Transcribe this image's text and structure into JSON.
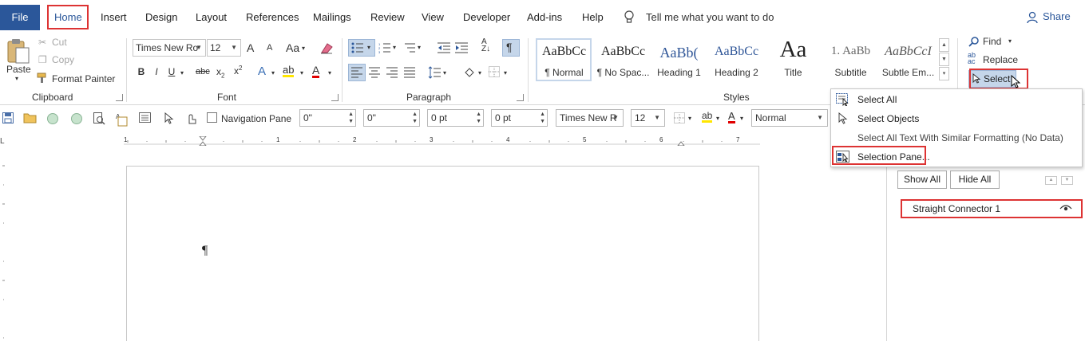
{
  "tabs": {
    "file": "File",
    "home": "Home",
    "insert": "Insert",
    "design": "Design",
    "layout": "Layout",
    "references": "References",
    "mailings": "Mailings",
    "review": "Review",
    "view": "View",
    "developer": "Developer",
    "addins": "Add-ins",
    "help": "Help",
    "tell_me": "Tell me what you want to do",
    "share": "Share"
  },
  "clipboard": {
    "paste": "Paste",
    "cut": "Cut",
    "copy": "Copy",
    "format_painter": "Format Painter",
    "group_label": "Clipboard"
  },
  "font": {
    "font_name": "Times New Ro",
    "font_size": "12",
    "grow": "A",
    "shrink": "A",
    "change_case": "Aa",
    "bold": "B",
    "italic": "I",
    "underline": "U",
    "strikethrough": "abc",
    "subscript": "x",
    "superscript": "x",
    "group_label": "Font"
  },
  "paragraph": {
    "group_label": "Paragraph",
    "show_marks": "¶"
  },
  "styles": {
    "group_label": "Styles",
    "items": [
      {
        "sample": "AaBbCc",
        "name": "¶ Normal"
      },
      {
        "sample": "AaBbCc",
        "name": "¶ No Spac..."
      },
      {
        "sample": "AaBb(",
        "name": "Heading 1"
      },
      {
        "sample": "AaBbCc",
        "name": "Heading 2"
      },
      {
        "sample": "Aa",
        "name": "Title"
      },
      {
        "sample": "1.  AaBb",
        "name": "Subtitle"
      },
      {
        "sample": "AaBbCcI",
        "name": "Subtle Em..."
      }
    ]
  },
  "editing": {
    "find": "Find",
    "replace": "Replace",
    "select": "Select"
  },
  "select_menu": {
    "select_all": "Select All",
    "select_objects": "Select Objects",
    "select_similar": "Select All Text With Similar Formatting (No Data)",
    "selection_pane": "Selection Pane..."
  },
  "quick_access": {
    "nav_pane": "Navigation Pane",
    "indent_left": "0\"",
    "indent_right": "0\"",
    "space_before": "0 pt",
    "space_after": "0 pt",
    "font_name": "Times New R",
    "font_size": "12",
    "style": "Normal"
  },
  "ruler": {
    "corner": "L",
    "numbers": [
      "1",
      "1",
      "2",
      "3",
      "4",
      "5",
      "6",
      "7"
    ]
  },
  "document": {
    "pilcrow": "¶"
  },
  "selection_pane": {
    "show_all": "Show All",
    "hide_all": "Hide All",
    "items": [
      {
        "name": "Straight Connector 1"
      }
    ]
  },
  "colors": {
    "accent": "#2b579a",
    "highlight_box": "#dd3333",
    "selected_fill": "#c5d6ea"
  }
}
